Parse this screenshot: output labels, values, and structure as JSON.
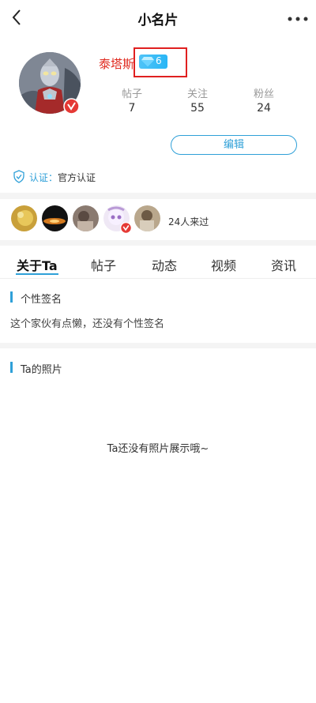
{
  "header": {
    "title": "小名片"
  },
  "profile": {
    "username": "泰塔斯",
    "level": "6",
    "stats": [
      {
        "label": "帖子",
        "value": "7"
      },
      {
        "label": "关注",
        "value": "55"
      },
      {
        "label": "粉丝",
        "value": "24"
      }
    ],
    "edit_label": "编辑",
    "cert_label": "认证：",
    "cert_value": "官方认证"
  },
  "visitors": {
    "count_text": "24人来过"
  },
  "tabs": [
    {
      "label": "关于Ta",
      "active": true
    },
    {
      "label": "帖子"
    },
    {
      "label": "动态"
    },
    {
      "label": "视频"
    },
    {
      "label": "资讯"
    }
  ],
  "about": {
    "signature_title": "个性签名",
    "signature_text": "这个家伙有点懒，还没有个性签名",
    "photos_title": "Ta的照片",
    "photos_empty": "Ta还没有照片展示哦~"
  },
  "colors": {
    "accent": "#2fa0d8",
    "username": "#e02b20",
    "badge": "#e53935",
    "level": "#29b6f6"
  },
  "icons": {
    "back": "chevron-left-icon",
    "more": "more-dots-icon",
    "verified": "verified-badge-icon",
    "diamond": "diamond-icon",
    "shield": "shield-check-icon"
  }
}
